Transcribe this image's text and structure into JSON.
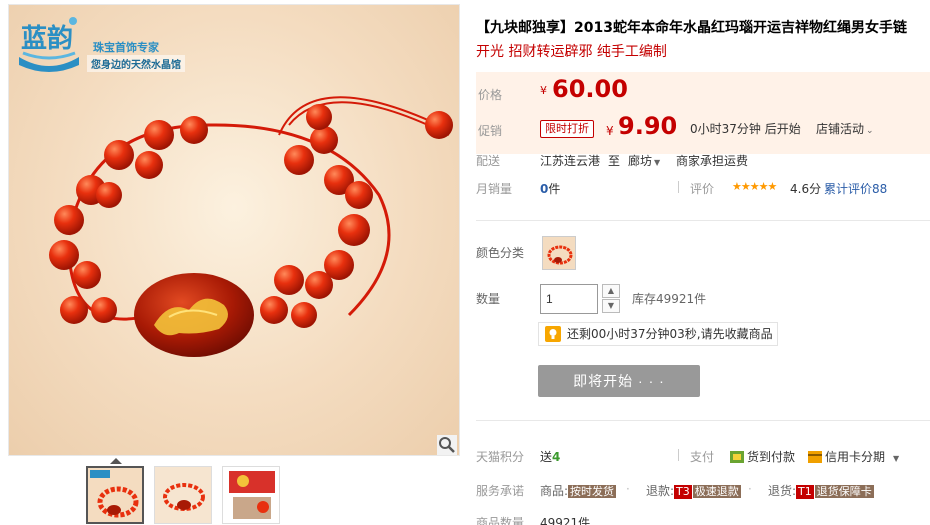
{
  "gallery": {
    "brand": {
      "name": "珠宝首饰专家",
      "slogan": "您身边的天然水晶馆"
    },
    "thumbnails": [
      {
        "selected": true
      },
      {
        "selected": false
      },
      {
        "selected": false
      }
    ]
  },
  "product": {
    "title": "【九块邮独享】2013蛇年本命年水晶红玛瑙开运吉祥物红绳男女手链",
    "subtitle": "开光 招财转运辟邪 纯手工编制"
  },
  "price": {
    "label": "价格",
    "currency": "¥",
    "original": "60.00"
  },
  "promo": {
    "label": "促销",
    "tag": "限时打折",
    "currency": "¥",
    "price": "9.90",
    "countdown": "0小时37分钟 后开始",
    "shop_activity": "店铺活动"
  },
  "delivery": {
    "label": "配送",
    "from": "江苏连云港",
    "to_word": "至",
    "to": "廊坊",
    "freight": "商家承担运费"
  },
  "sales": {
    "label": "月销量",
    "count": "0",
    "unit": "件",
    "rating_label": "评价",
    "stars": "★★★★★",
    "score": "4.6分",
    "reviews": "累计评价88"
  },
  "color": {
    "label": "颜色分类"
  },
  "quantity": {
    "label": "数量",
    "value": "1",
    "stock": "库存49921件"
  },
  "tip": {
    "text": "还剩00小时37分钟03秒,请先收藏商品"
  },
  "buy_button": {
    "label": "即将开始  · · ·"
  },
  "points": {
    "label": "天猫积分",
    "send": "送",
    "amount": "4",
    "pay_label": "支付",
    "cod": "货到付款",
    "credit": "信用卡分期"
  },
  "service": {
    "label": "服务承诺",
    "goods_label": "商品:",
    "goods_badge": "按时发货",
    "refund_label": "退款:",
    "refund_code": "T3",
    "refund_badge": "极速退款",
    "return_label": "退货:",
    "return_code": "T1",
    "return_badge": "退货保障卡"
  },
  "footer_partial": {
    "label": "商品数量",
    "value": "49921件"
  },
  "colors": {
    "accent_red": "#c40000",
    "price_bg": "#fff2e8",
    "button_gray": "#999999",
    "star_orange": "#ff9900",
    "badge_brown": "#7a5c48"
  }
}
